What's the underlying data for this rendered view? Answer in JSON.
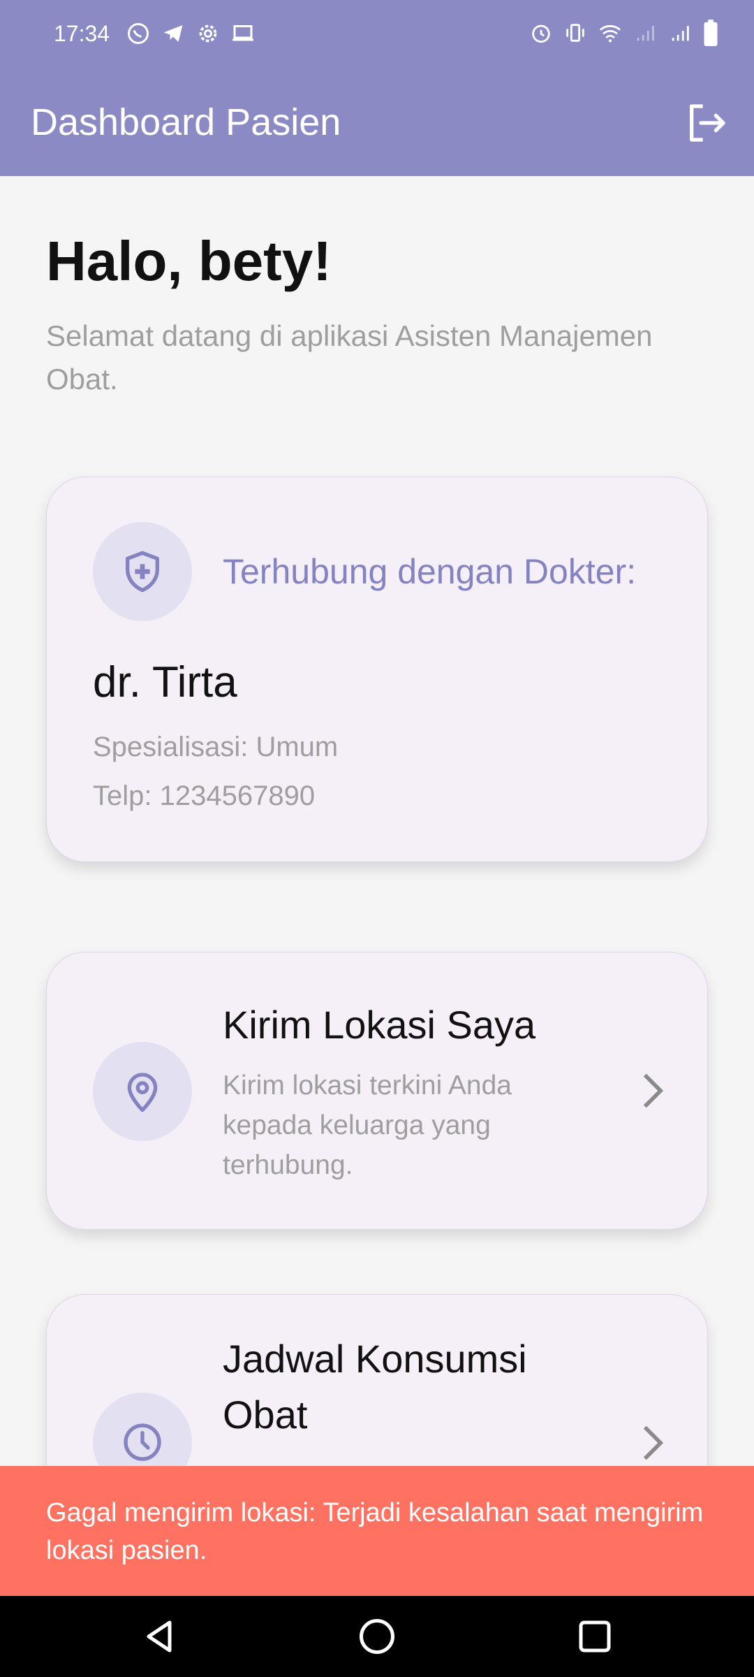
{
  "status_bar": {
    "time": "17:34",
    "left_icons": [
      "whatsapp-icon",
      "telegram-icon",
      "settings-icon",
      "laptop-icon"
    ],
    "right_icons": [
      "alarm-icon",
      "vibrate-icon",
      "wifi-icon",
      "signal-icon",
      "signal-icon",
      "battery-icon"
    ]
  },
  "app_bar": {
    "title": "Dashboard Pasien",
    "background": "#8b8ac4",
    "logout_icon": "logout-icon"
  },
  "greeting": {
    "title": "Halo, bety!",
    "subtitle": "Selamat datang di aplikasi Asisten Manajemen Obat."
  },
  "doctor_card": {
    "icon": "shield-plus-icon",
    "heading": "Terhubung dengan Dokter:",
    "name": "dr. Tirta",
    "specialization": "Spesialisasi: Umum",
    "phone": "Telp: 1234567890"
  },
  "location_card": {
    "icon": "location-pin-icon",
    "title": "Kirim Lokasi Saya",
    "description": "Kirim lokasi terkini Anda kepada keluarga yang terhubung."
  },
  "schedule_card": {
    "icon": "clock-icon",
    "title": "Jadwal Konsumsi Obat"
  },
  "snackbar": {
    "message": "Gagal mengirim lokasi: Terjadi kesalahan saat mengirim lokasi pasien.",
    "background": "#ff7262"
  },
  "nav_bar": {
    "buttons": [
      "back-icon",
      "home-icon",
      "recents-icon"
    ]
  },
  "colors": {
    "accent": "#8b8ac4",
    "card_bg": "#f5eff8",
    "icon_circle": "#e3e0f1",
    "error": "#ff7262"
  }
}
